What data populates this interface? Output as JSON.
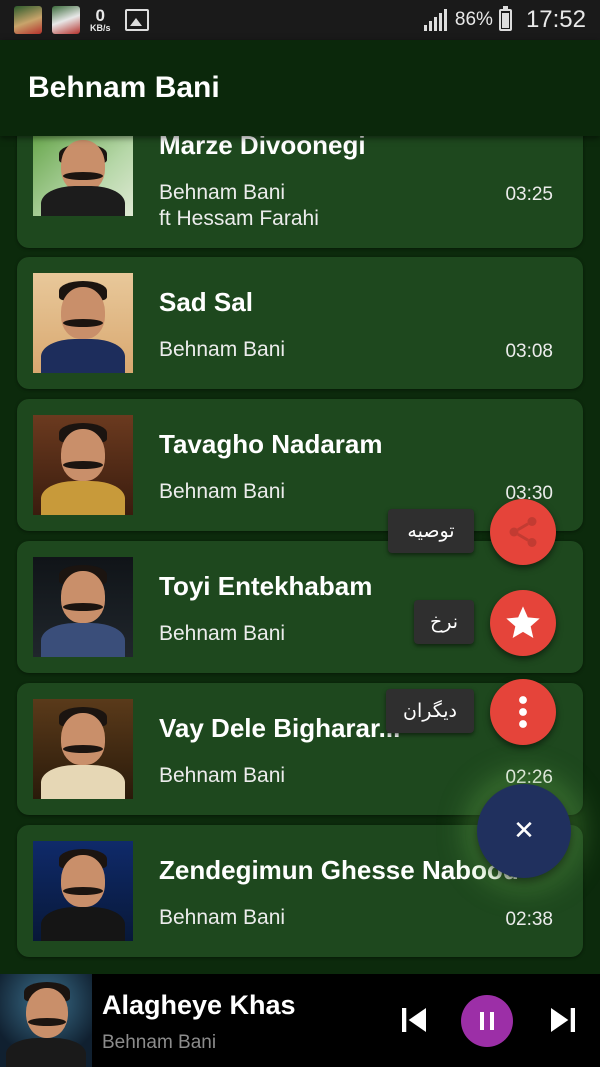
{
  "status_bar": {
    "kbs_value": "0",
    "kbs_unit": "KB/s",
    "battery": "86%",
    "battery_level": 0.86,
    "time": "17:52"
  },
  "app_bar": {
    "title": "Behnam Bani"
  },
  "songs": [
    {
      "title": "Marze Divoonegi",
      "artist": "Behnam Bani",
      "artist_line2": "ft Hessam Farahi",
      "duration": "03:25"
    },
    {
      "title": "Sad Sal",
      "artist": "Behnam Bani",
      "duration": "03:08"
    },
    {
      "title": "Tavagho Nadaram",
      "artist": "Behnam Bani",
      "duration": "03:30"
    },
    {
      "title": "Toyi Entekhabam",
      "artist": "Behnam Bani",
      "duration": ""
    },
    {
      "title": "Vay Dele Bigharar...",
      "artist": "Behnam Bani",
      "duration": "02:26"
    },
    {
      "title": "Zendegimun Ghesse Nabood",
      "artist": "Behnam Bani",
      "duration": "02:38"
    }
  ],
  "speed_dial": {
    "share_label": "توصیه",
    "share_icon": "share-icon",
    "rate_label": "نرخ",
    "rate_icon": "star-icon",
    "more_label": "دیگران",
    "more_icon": "more-vertical-icon",
    "close_icon": "close-icon",
    "close_glyph": "✕"
  },
  "player": {
    "title": "Alagheye Khas",
    "artist": "Behnam Bani",
    "state": "playing"
  },
  "colors": {
    "background": "#0c2a0c",
    "card": "#1e481e",
    "fab_mini": "#e5443a",
    "fab_main": "#20305e",
    "pause": "#9c2fa7"
  }
}
